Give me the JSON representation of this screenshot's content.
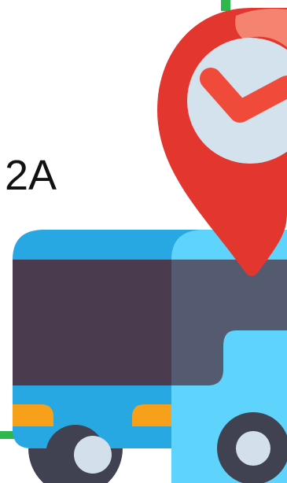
{
  "route": {
    "label": "2A"
  },
  "icons": {
    "bus": "bus-icon",
    "location_pin": "location-pin-icon",
    "checkmark": "checkmark-icon"
  },
  "colors": {
    "background": "#ffffff",
    "route_line": "#2db84d",
    "bus_body_dark_blue": "#27a8e3",
    "bus_body_light_blue": "#5ed4fc",
    "bus_window_dark": "#4a3c4e",
    "bus_window_side": "#545a6f",
    "bus_headlight": "#f7a11a",
    "wheel_dark": "#404252",
    "wheel_hub": "#d3e0ec",
    "pin_red": "#e2362f",
    "pin_highlight": "#f4836f",
    "pin_inner_circle": "#d4e2ee",
    "check_red": "#f04b3a"
  }
}
